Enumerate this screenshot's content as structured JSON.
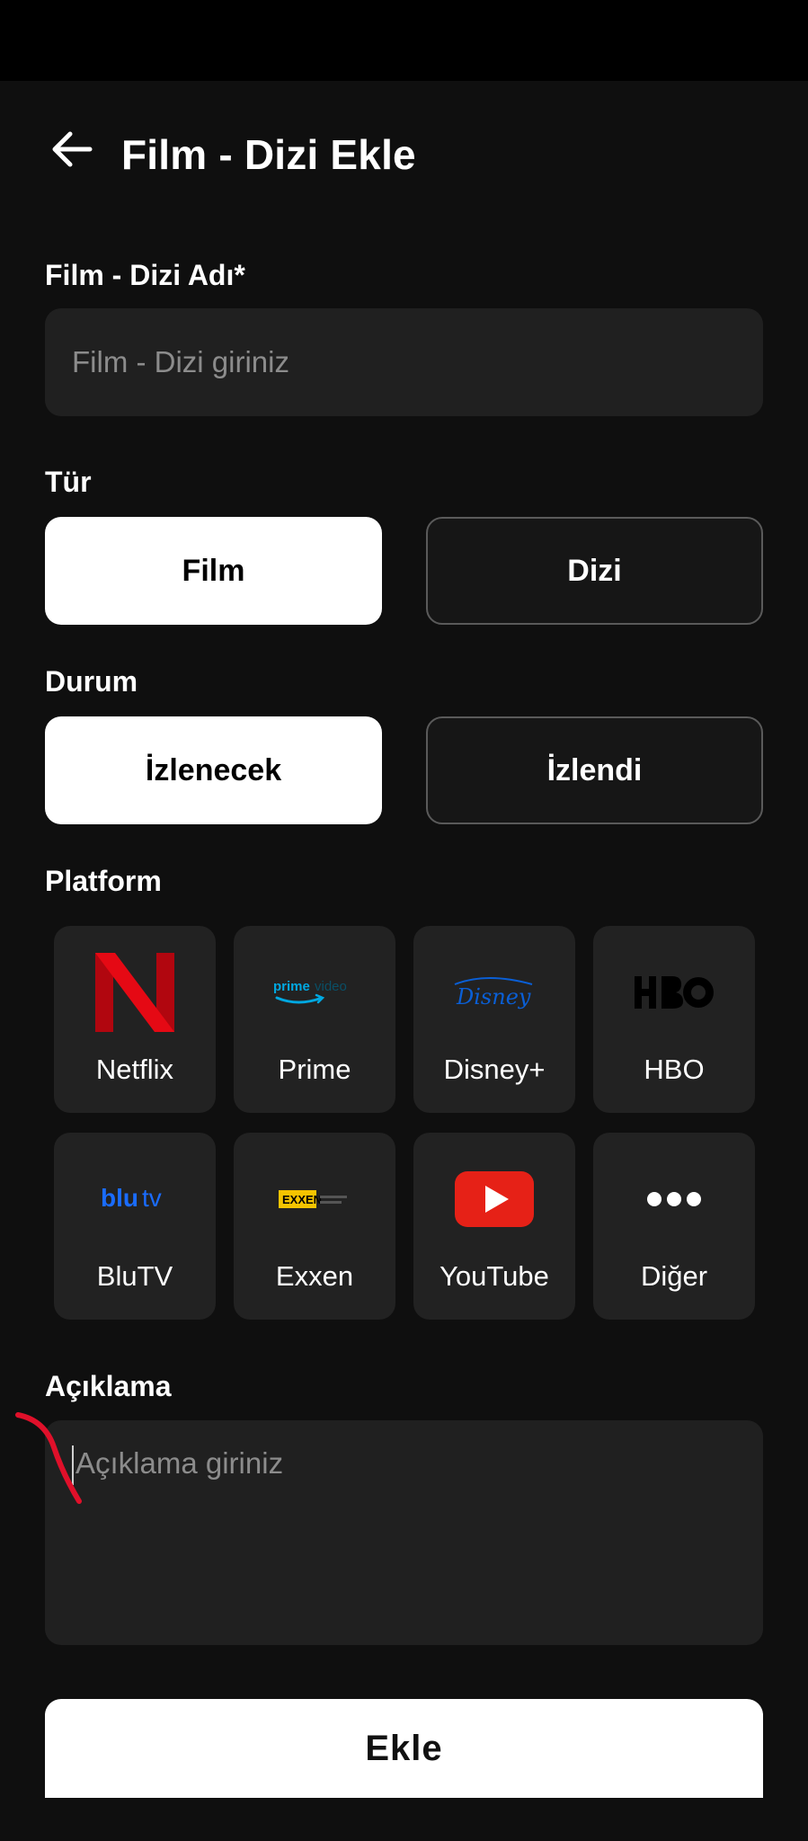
{
  "header": {
    "title": "Film - Dizi Ekle"
  },
  "form": {
    "name": {
      "label": "Film - Dizi Adı*",
      "placeholder": "Film - Dizi giriniz",
      "value": ""
    },
    "type": {
      "label": "Tür",
      "options": [
        "Film",
        "Dizi"
      ],
      "selected": "Film"
    },
    "status": {
      "label": "Durum",
      "options": [
        "İzlenecek",
        "İzlendi"
      ],
      "selected": "İzlenecek"
    },
    "platform": {
      "label": "Platform",
      "items": [
        {
          "label": "Netflix",
          "icon": "netflix-logo",
          "color": "#e50914"
        },
        {
          "label": "Prime",
          "icon": "prime-video-logo",
          "color": "#00a8e1"
        },
        {
          "label": "Disney+",
          "icon": "disney-logo",
          "color": "#0a5fd6"
        },
        {
          "label": "HBO",
          "icon": "hbo-logo",
          "color": "#000000"
        },
        {
          "label": "BluTV",
          "icon": "blutv-logo",
          "color": "#1a6cff"
        },
        {
          "label": "Exxen",
          "icon": "exxen-logo",
          "color": "#f5c400"
        },
        {
          "label": "YouTube",
          "icon": "youtube-logo",
          "color": "#e62117"
        },
        {
          "label": "Diğer",
          "icon": "more-dots-icon",
          "color": "#ffffff"
        }
      ]
    },
    "description": {
      "label": "Açıklama",
      "placeholder": "Açıklama giriniz",
      "value": ""
    },
    "submit_label": "Ekle"
  }
}
